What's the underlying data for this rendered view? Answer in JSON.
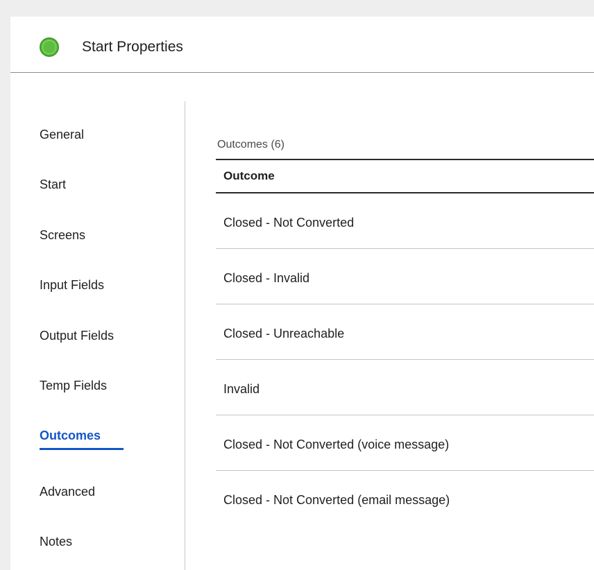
{
  "header": {
    "title": "Start Properties",
    "status_color": "#5ebd3e"
  },
  "sidebar": {
    "items": [
      {
        "label": "General"
      },
      {
        "label": "Start"
      },
      {
        "label": "Screens"
      },
      {
        "label": "Input Fields"
      },
      {
        "label": "Output Fields"
      },
      {
        "label": "Temp Fields"
      },
      {
        "label": "Outcomes",
        "active": true
      },
      {
        "label": "Advanced"
      },
      {
        "label": "Notes"
      }
    ],
    "active_color": "#1456c8"
  },
  "main": {
    "outcomes_count": "Outcomes (6)",
    "table": {
      "column_header": "Outcome",
      "rows": [
        "Closed - Not Converted",
        "Closed - Invalid",
        "Closed - Unreachable",
        "Invalid",
        "Closed - Not Converted (voice message)",
        "Closed - Not Converted (email message)"
      ]
    }
  }
}
